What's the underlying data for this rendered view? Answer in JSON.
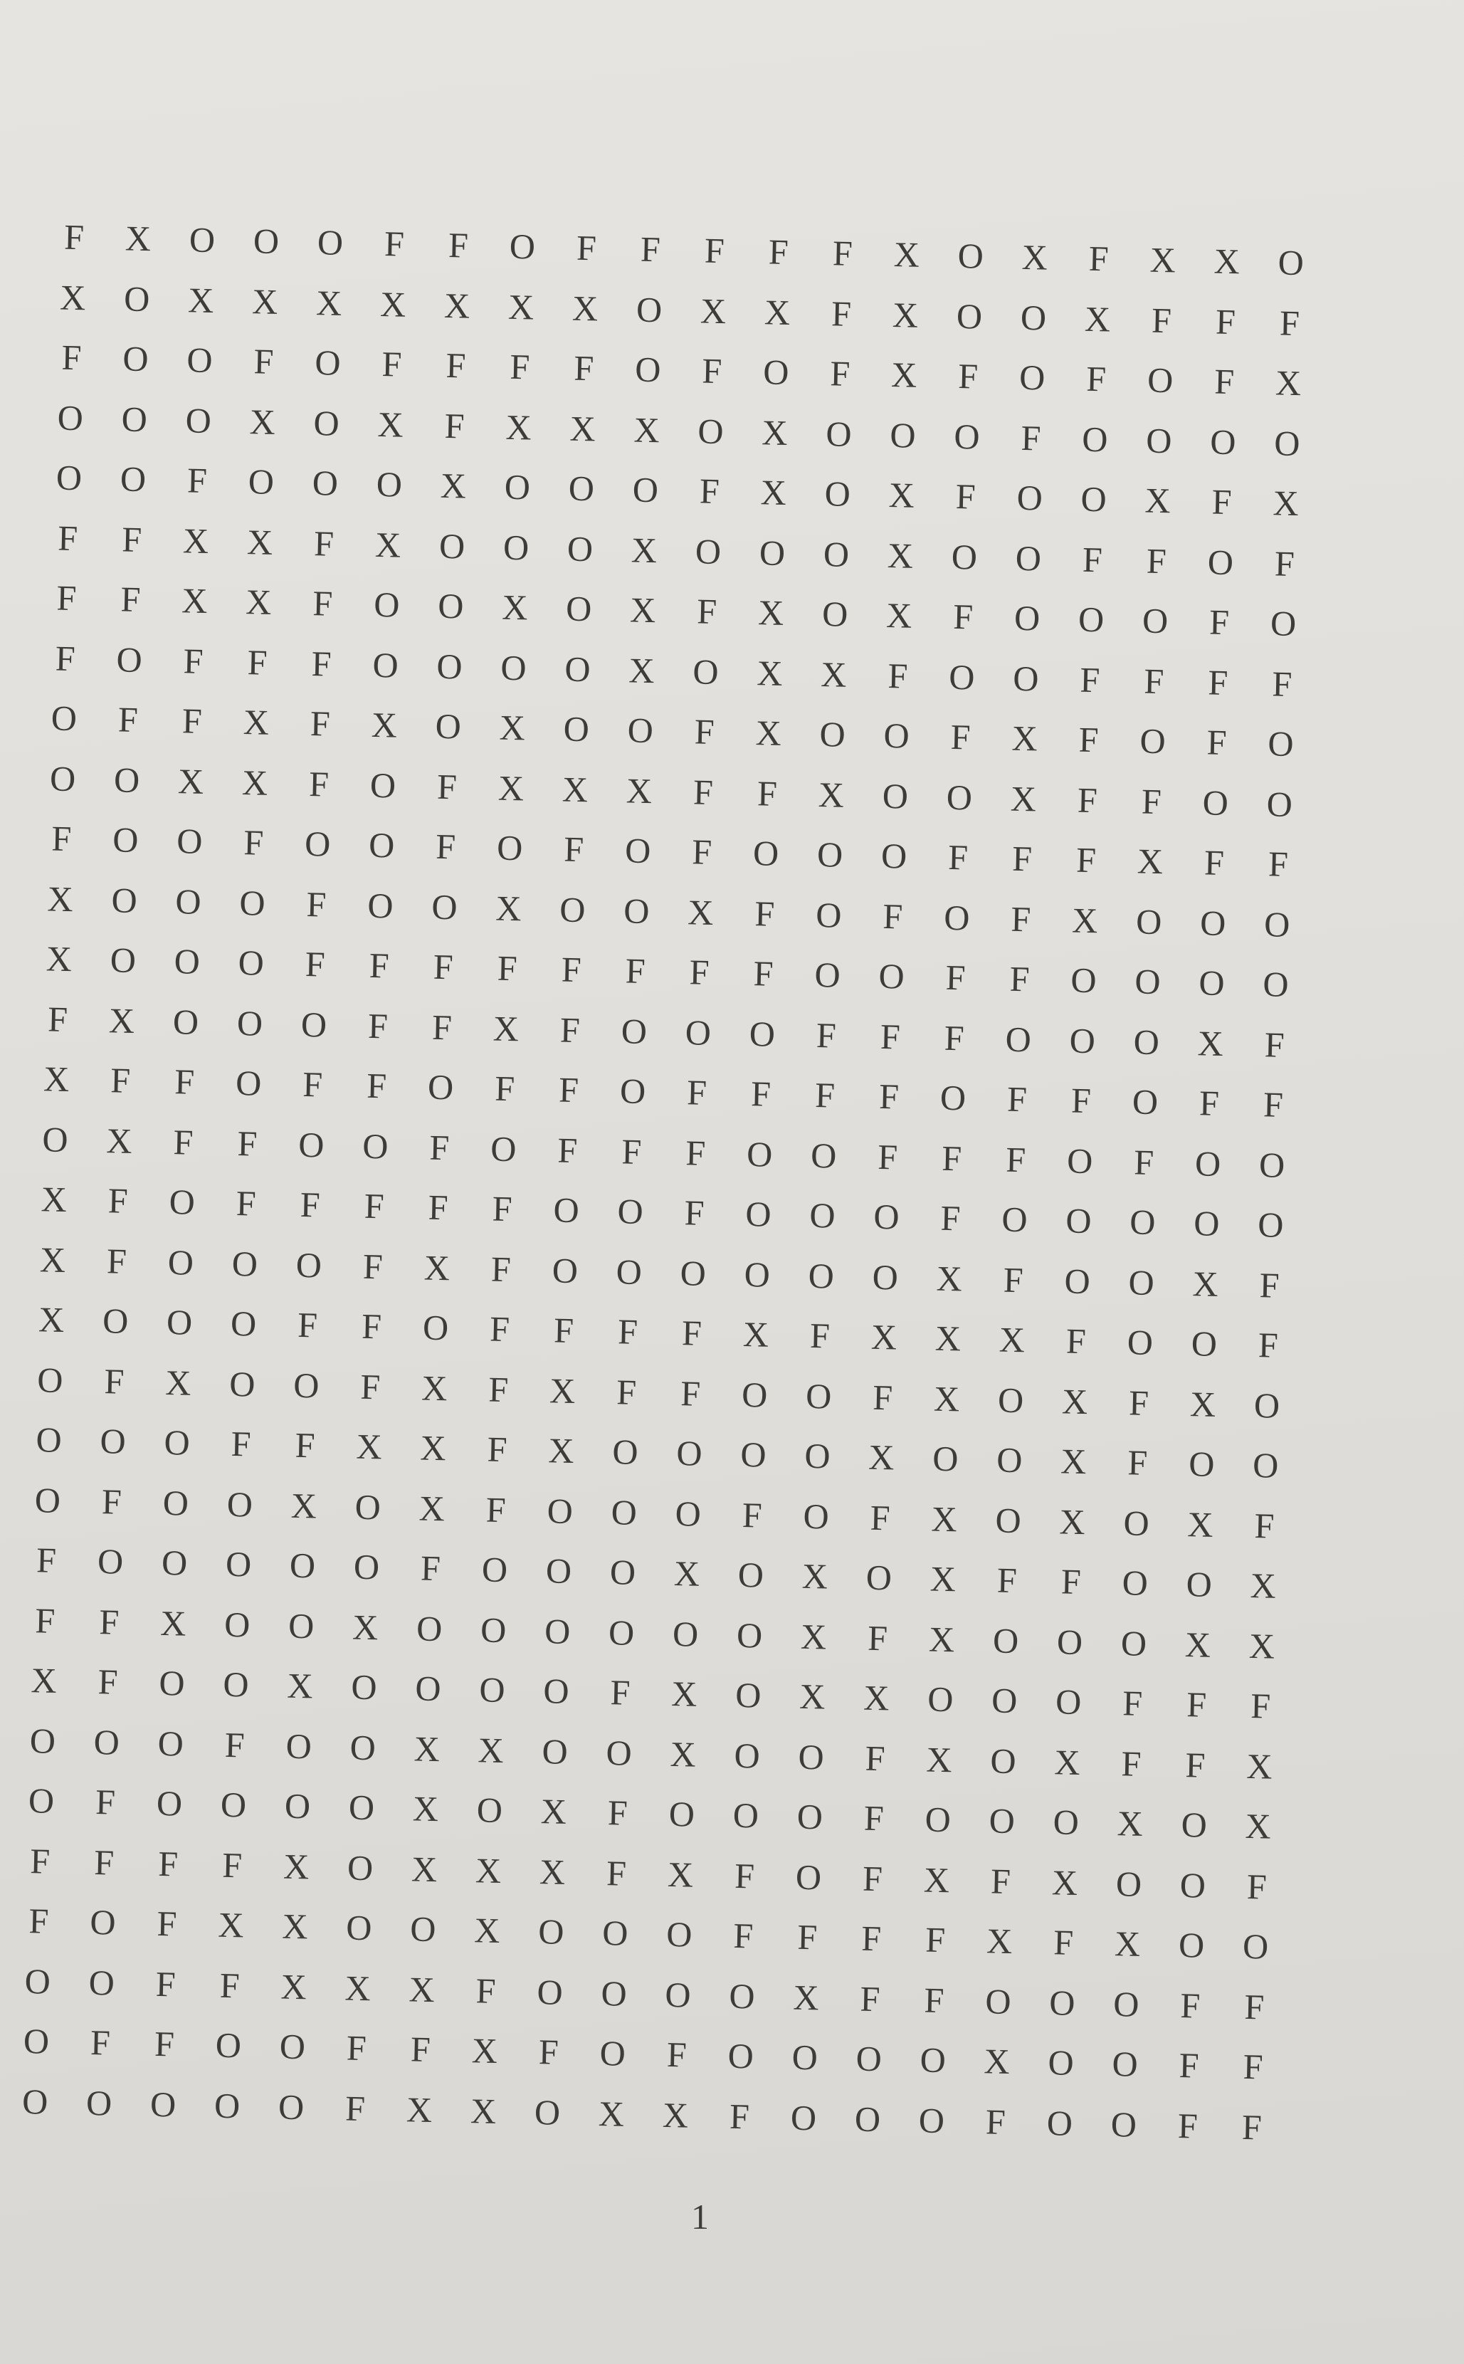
{
  "page": {
    "number": "1"
  },
  "grid": {
    "rows": [
      [
        "F",
        "X",
        "O",
        "O",
        "O",
        "F",
        "F",
        "O",
        "F",
        "F",
        "F",
        "F",
        "F",
        "X",
        "O",
        "X",
        "F",
        "X",
        "X",
        "O"
      ],
      [
        "X",
        "O",
        "X",
        "X",
        "X",
        "X",
        "X",
        "X",
        "X",
        "O",
        "X",
        "X",
        "F",
        "X",
        "O",
        "O",
        "X",
        "F",
        "F",
        "F"
      ],
      [
        "F",
        "O",
        "O",
        "F",
        "O",
        "F",
        "F",
        "F",
        "F",
        "O",
        "F",
        "O",
        "F",
        "X",
        "F",
        "O",
        "F",
        "O",
        "F",
        "X"
      ],
      [
        "O",
        "O",
        "O",
        "X",
        "O",
        "X",
        "F",
        "X",
        "X",
        "X",
        "O",
        "X",
        "O",
        "O",
        "O",
        "F",
        "O",
        "O",
        "O",
        "O"
      ],
      [
        "O",
        "O",
        "F",
        "O",
        "O",
        "O",
        "X",
        "O",
        "O",
        "O",
        "F",
        "X",
        "O",
        "X",
        "F",
        "O",
        "O",
        "X",
        "F",
        "X"
      ],
      [
        "F",
        "F",
        "X",
        "X",
        "F",
        "X",
        "O",
        "O",
        "O",
        "X",
        "O",
        "O",
        "O",
        "X",
        "O",
        "O",
        "F",
        "F",
        "O",
        "F"
      ],
      [
        "F",
        "F",
        "X",
        "X",
        "F",
        "O",
        "O",
        "X",
        "O",
        "X",
        "F",
        "X",
        "O",
        "X",
        "F",
        "O",
        "O",
        "O",
        "F",
        "O"
      ],
      [
        "F",
        "O",
        "F",
        "F",
        "F",
        "O",
        "O",
        "O",
        "O",
        "X",
        "O",
        "X",
        "X",
        "F",
        "O",
        "O",
        "F",
        "F",
        "F",
        "F"
      ],
      [
        "O",
        "F",
        "F",
        "X",
        "F",
        "X",
        "O",
        "X",
        "O",
        "O",
        "F",
        "X",
        "O",
        "O",
        "F",
        "X",
        "F",
        "O",
        "F",
        "O"
      ],
      [
        "O",
        "O",
        "X",
        "X",
        "F",
        "O",
        "F",
        "X",
        "X",
        "X",
        "F",
        "F",
        "X",
        "O",
        "O",
        "X",
        "F",
        "F",
        "O",
        "O"
      ],
      [
        "F",
        "O",
        "O",
        "F",
        "O",
        "O",
        "F",
        "O",
        "F",
        "O",
        "F",
        "O",
        "O",
        "O",
        "F",
        "F",
        "F",
        "X",
        "F",
        "F"
      ],
      [
        "X",
        "O",
        "O",
        "O",
        "F",
        "O",
        "O",
        "X",
        "O",
        "O",
        "X",
        "F",
        "O",
        "F",
        "O",
        "F",
        "X",
        "O",
        "O",
        "O"
      ],
      [
        "X",
        "O",
        "O",
        "O",
        "F",
        "F",
        "F",
        "F",
        "F",
        "F",
        "F",
        "F",
        "O",
        "O",
        "F",
        "F",
        "O",
        "O",
        "O",
        "O"
      ],
      [
        "F",
        "X",
        "O",
        "O",
        "O",
        "F",
        "F",
        "X",
        "F",
        "O",
        "O",
        "O",
        "F",
        "F",
        "F",
        "O",
        "O",
        "O",
        "X",
        "F"
      ],
      [
        "X",
        "F",
        "F",
        "O",
        "F",
        "F",
        "O",
        "F",
        "F",
        "O",
        "F",
        "F",
        "F",
        "F",
        "O",
        "F",
        "F",
        "O",
        "F",
        "F"
      ],
      [
        "O",
        "X",
        "F",
        "F",
        "O",
        "O",
        "F",
        "O",
        "F",
        "F",
        "F",
        "O",
        "O",
        "F",
        "F",
        "F",
        "O",
        "F",
        "O",
        "O"
      ],
      [
        "X",
        "F",
        "O",
        "F",
        "F",
        "F",
        "F",
        "F",
        "O",
        "O",
        "F",
        "O",
        "O",
        "O",
        "F",
        "O",
        "O",
        "O",
        "O",
        "O"
      ],
      [
        "X",
        "F",
        "O",
        "O",
        "O",
        "F",
        "X",
        "F",
        "O",
        "O",
        "O",
        "O",
        "O",
        "O",
        "X",
        "F",
        "O",
        "O",
        "X",
        "F"
      ],
      [
        "X",
        "O",
        "O",
        "O",
        "F",
        "F",
        "O",
        "F",
        "F",
        "F",
        "F",
        "X",
        "F",
        "X",
        "X",
        "X",
        "F",
        "O",
        "O",
        "F"
      ],
      [
        "O",
        "F",
        "X",
        "O",
        "O",
        "F",
        "X",
        "F",
        "X",
        "F",
        "F",
        "O",
        "O",
        "F",
        "X",
        "O",
        "X",
        "F",
        "X",
        "O"
      ],
      [
        "O",
        "O",
        "O",
        "F",
        "F",
        "X",
        "X",
        "F",
        "X",
        "O",
        "O",
        "O",
        "O",
        "X",
        "O",
        "O",
        "X",
        "F",
        "O",
        "O"
      ],
      [
        "O",
        "F",
        "O",
        "O",
        "X",
        "O",
        "X",
        "F",
        "O",
        "O",
        "O",
        "F",
        "O",
        "F",
        "X",
        "O",
        "X",
        "O",
        "X",
        "F"
      ],
      [
        "F",
        "O",
        "O",
        "O",
        "O",
        "O",
        "F",
        "O",
        "O",
        "O",
        "X",
        "O",
        "X",
        "O",
        "X",
        "F",
        "F",
        "O",
        "O",
        "X"
      ],
      [
        "F",
        "F",
        "X",
        "O",
        "O",
        "X",
        "O",
        "O",
        "O",
        "O",
        "O",
        "O",
        "X",
        "F",
        "X",
        "O",
        "O",
        "O",
        "X",
        "X"
      ],
      [
        "X",
        "F",
        "O",
        "O",
        "X",
        "O",
        "O",
        "O",
        "O",
        "F",
        "X",
        "O",
        "X",
        "X",
        "O",
        "O",
        "O",
        "F",
        "F",
        "F"
      ],
      [
        "O",
        "O",
        "O",
        "F",
        "O",
        "O",
        "X",
        "X",
        "O",
        "O",
        "X",
        "O",
        "O",
        "F",
        "X",
        "O",
        "X",
        "F",
        "F",
        "X"
      ],
      [
        "O",
        "F",
        "O",
        "O",
        "O",
        "O",
        "X",
        "O",
        "X",
        "F",
        "O",
        "O",
        "O",
        "F",
        "O",
        "O",
        "O",
        "X",
        "O",
        "X"
      ],
      [
        "F",
        "F",
        "F",
        "F",
        "X",
        "O",
        "X",
        "X",
        "X",
        "F",
        "X",
        "F",
        "O",
        "F",
        "X",
        "F",
        "X",
        "O",
        "O",
        "F"
      ],
      [
        "F",
        "O",
        "F",
        "X",
        "X",
        "O",
        "O",
        "X",
        "O",
        "O",
        "O",
        "F",
        "F",
        "F",
        "F",
        "X",
        "F",
        "X",
        "O",
        "O"
      ],
      [
        "O",
        "O",
        "F",
        "F",
        "X",
        "X",
        "X",
        "F",
        "O",
        "O",
        "O",
        "O",
        "X",
        "F",
        "F",
        "O",
        "O",
        "O",
        "F",
        "F"
      ],
      [
        "O",
        "F",
        "F",
        "O",
        "O",
        "F",
        "F",
        "X",
        "F",
        "O",
        "F",
        "O",
        "O",
        "O",
        "O",
        "X",
        "O",
        "O",
        "F",
        "F"
      ],
      [
        "O",
        "O",
        "O",
        "O",
        "O",
        "F",
        "X",
        "X",
        "O",
        "X",
        "X",
        "F",
        "O",
        "O",
        "O",
        "F",
        "O",
        "O",
        "F",
        "F"
      ]
    ]
  }
}
